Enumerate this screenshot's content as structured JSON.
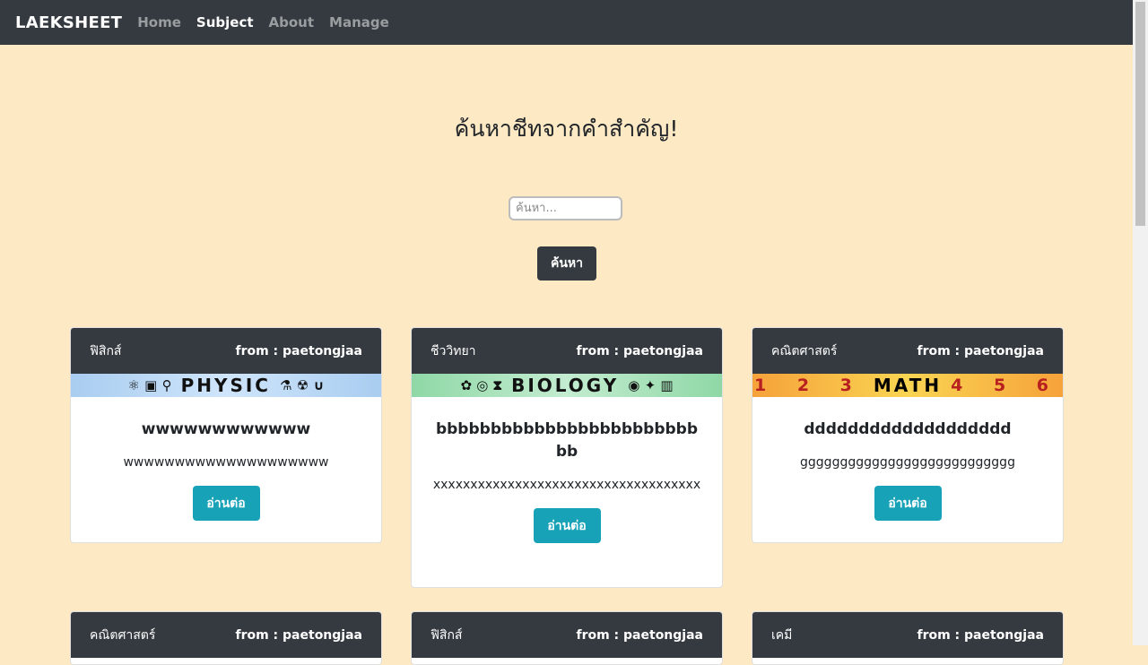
{
  "nav": {
    "brand": "LAEKSHEET",
    "links": [
      "Home",
      "Subject",
      "About",
      "Manage"
    ]
  },
  "hero": {
    "title": "ค้นหาชีทจากคำสำคัญ!",
    "search_placeholder": "ค้นหา...",
    "search_button": "ค้นหา"
  },
  "cards": [
    {
      "subject": "ฟิสิกส์",
      "from": "from : paetongjaa",
      "banner": "PHYSIC",
      "banner_left": "⚛ ▣ ⚲",
      "banner_right": "⚗ ☢ ∪",
      "title": "wwwwwwwwwwww",
      "text": "wwwwwwwwwwwwwwwwwwww",
      "button": "อ่านต่อ"
    },
    {
      "subject": "ชีววิทยา",
      "from": "from : paetongjaa",
      "banner": "BIOLOGY",
      "banner_left": "✿ ◎ ⧗",
      "banner_right": "◉ ✦ ▥",
      "title": "bbbbbbbbbbbbbbbbbbbbbbbbbb",
      "text": "xxxxxxxxxxxxxxxxxxxxxxxxxxxxxxxxxxxx",
      "button": "อ่านต่อ"
    },
    {
      "subject": "คณิตศาสตร์",
      "from": "from : paetongjaa",
      "banner": "MATH",
      "banner_left": "1 2 3",
      "banner_right": "4 5 6",
      "title": "ddddddddddddddddddd",
      "text": "ggggggggggggggggggggggggggg",
      "button": "อ่านต่อ"
    },
    {
      "subject": "คณิตศาสตร์",
      "from": "from : paetongjaa"
    },
    {
      "subject": "ฟิสิกส์",
      "from": "from : paetongjaa"
    },
    {
      "subject": "เคมี",
      "from": "from : paetongjaa"
    }
  ]
}
